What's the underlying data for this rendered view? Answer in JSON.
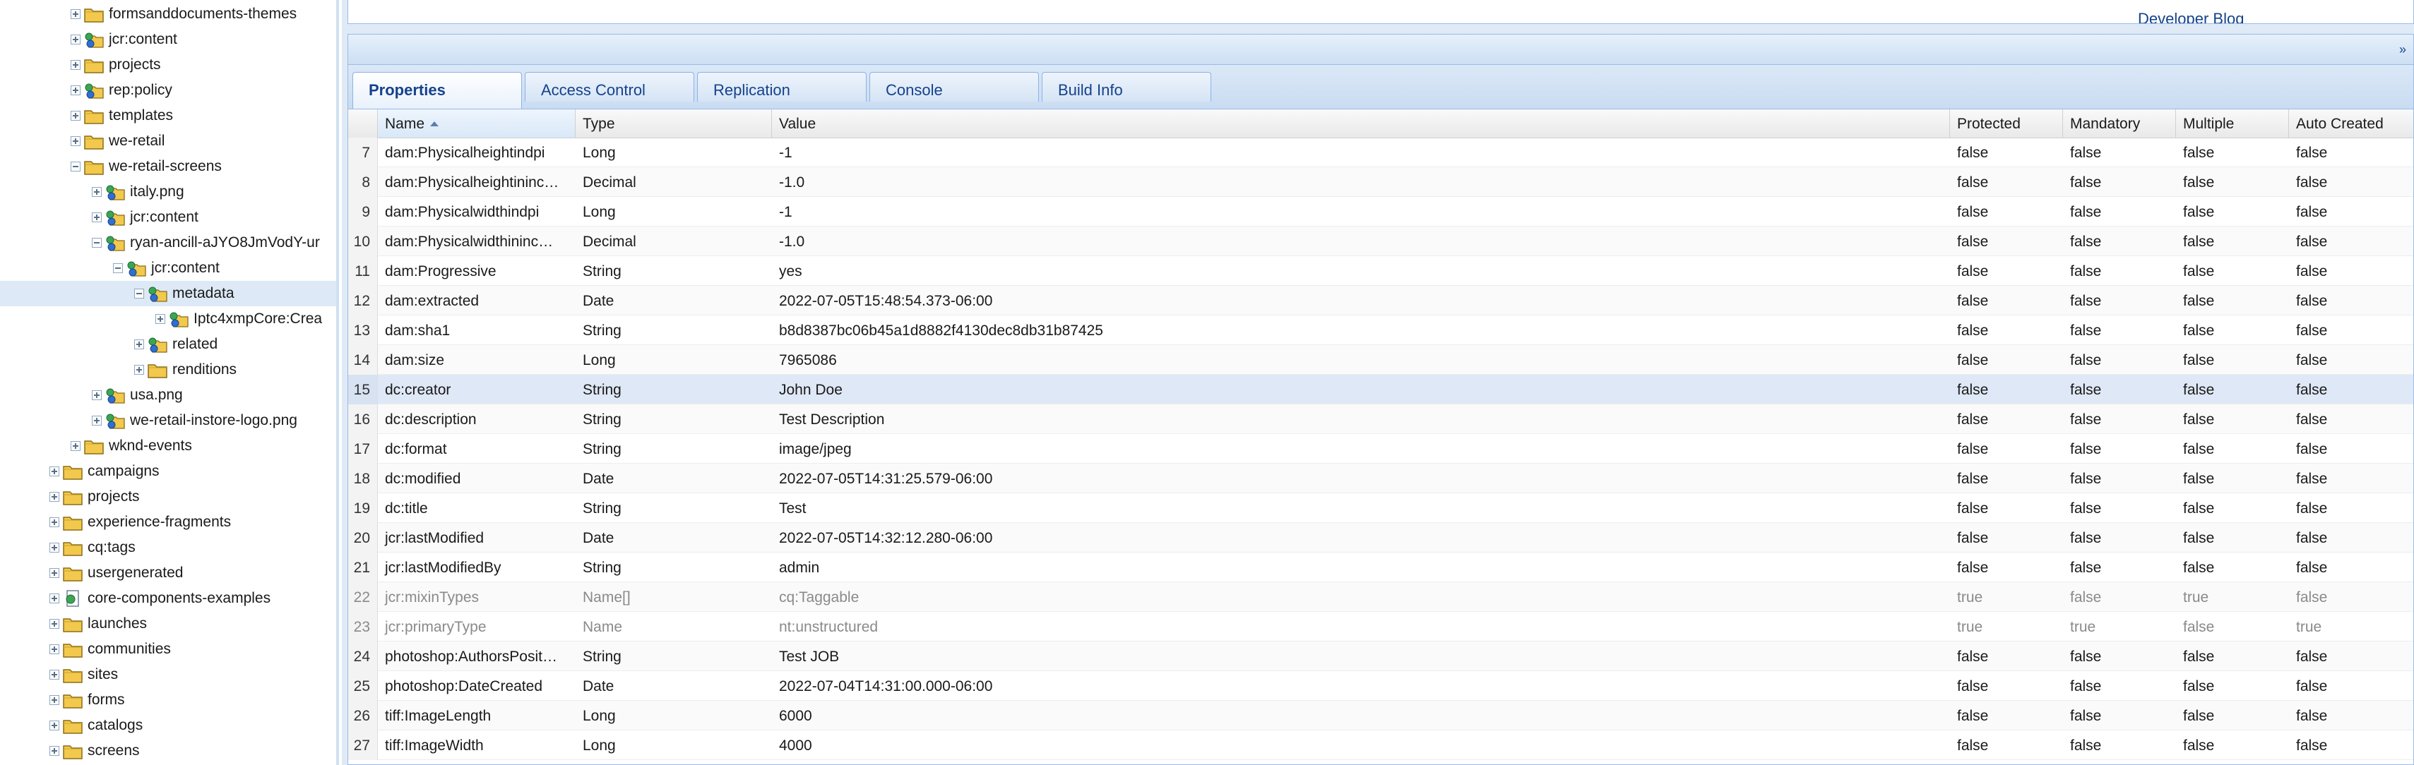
{
  "tree": {
    "items": [
      {
        "label": "formsanddocuments-themes",
        "toggle": "plus",
        "icon": "folder",
        "level": 3
      },
      {
        "label": "jcr:content",
        "toggle": "plus",
        "icon": "node",
        "level": 3
      },
      {
        "label": "projects",
        "toggle": "plus",
        "icon": "folder",
        "level": 3
      },
      {
        "label": "rep:policy",
        "toggle": "plus",
        "icon": "node",
        "level": 3
      },
      {
        "label": "templates",
        "toggle": "plus",
        "icon": "folder",
        "level": 3
      },
      {
        "label": "we-retail",
        "toggle": "plus",
        "icon": "folder",
        "level": 3
      },
      {
        "label": "we-retail-screens",
        "toggle": "minus",
        "icon": "folder",
        "level": 3
      },
      {
        "label": "italy.png",
        "toggle": "plus",
        "icon": "node",
        "level": 4
      },
      {
        "label": "jcr:content",
        "toggle": "plus",
        "icon": "node",
        "level": 4
      },
      {
        "label": "ryan-ancill-aJYO8JmVodY-ur",
        "toggle": "minus",
        "icon": "node",
        "level": 4
      },
      {
        "label": "jcr:content",
        "toggle": "minus",
        "icon": "node",
        "level": 5
      },
      {
        "label": "metadata",
        "toggle": "minus",
        "icon": "node",
        "level": 6,
        "selected": true
      },
      {
        "label": "Iptc4xmpCore:Crea",
        "toggle": "plus",
        "icon": "node",
        "level": 7
      },
      {
        "label": "related",
        "toggle": "plus",
        "icon": "node",
        "level": 6
      },
      {
        "label": "renditions",
        "toggle": "plus",
        "icon": "folder",
        "level": 6
      },
      {
        "label": "usa.png",
        "toggle": "plus",
        "icon": "node",
        "level": 4
      },
      {
        "label": "we-retail-instore-logo.png",
        "toggle": "plus",
        "icon": "node",
        "level": 4
      },
      {
        "label": "wknd-events",
        "toggle": "plus",
        "icon": "folder",
        "level": 3
      },
      {
        "label": "campaigns",
        "toggle": "plus",
        "icon": "folder",
        "level": 2
      },
      {
        "label": "projects",
        "toggle": "plus",
        "icon": "folder",
        "level": 2
      },
      {
        "label": "experience-fragments",
        "toggle": "plus",
        "icon": "folder",
        "level": 2
      },
      {
        "label": "cq:tags",
        "toggle": "plus",
        "icon": "folder",
        "level": 2
      },
      {
        "label": "usergenerated",
        "toggle": "plus",
        "icon": "folder",
        "level": 2
      },
      {
        "label": "core-components-examples",
        "toggle": "plus",
        "icon": "page",
        "level": 2
      },
      {
        "label": "launches",
        "toggle": "plus",
        "icon": "folder",
        "level": 2
      },
      {
        "label": "communities",
        "toggle": "plus",
        "icon": "folder",
        "level": 2
      },
      {
        "label": "sites",
        "toggle": "plus",
        "icon": "folder",
        "level": 2
      },
      {
        "label": "forms",
        "toggle": "plus",
        "icon": "folder",
        "level": 2
      },
      {
        "label": "catalogs",
        "toggle": "plus",
        "icon": "folder",
        "level": 2
      },
      {
        "label": "screens",
        "toggle": "plus",
        "icon": "folder",
        "level": 2
      }
    ]
  },
  "top_panel": {
    "link": "Developer Blog"
  },
  "collapse_icon": "double-chevron-down-icon",
  "tabs": [
    {
      "label": "Properties",
      "active": true
    },
    {
      "label": "Access Control",
      "active": false
    },
    {
      "label": "Replication",
      "active": false
    },
    {
      "label": "Console",
      "active": false
    },
    {
      "label": "Build Info",
      "active": false
    }
  ],
  "grid": {
    "columns": [
      "",
      "Name",
      "Type",
      "Value",
      "Protected",
      "Mandatory",
      "Multiple",
      "Auto Created"
    ],
    "sorted_column": "Name",
    "rows": [
      [
        "7",
        "dam:Physicalheightindpi",
        "Long",
        "-1",
        "false",
        "false",
        "false",
        "false"
      ],
      [
        "8",
        "dam:Physicalheightininc…",
        "Decimal",
        "-1.0",
        "false",
        "false",
        "false",
        "false"
      ],
      [
        "9",
        "dam:Physicalwidthindpi",
        "Long",
        "-1",
        "false",
        "false",
        "false",
        "false"
      ],
      [
        "10",
        "dam:Physicalwidthininc…",
        "Decimal",
        "-1.0",
        "false",
        "false",
        "false",
        "false"
      ],
      [
        "11",
        "dam:Progressive",
        "String",
        "yes",
        "false",
        "false",
        "false",
        "false"
      ],
      [
        "12",
        "dam:extracted",
        "Date",
        "2022-07-05T15:48:54.373-06:00",
        "false",
        "false",
        "false",
        "false"
      ],
      [
        "13",
        "dam:sha1",
        "String",
        "b8d8387bc06b45a1d8882f4130dec8db31b87425",
        "false",
        "false",
        "false",
        "false"
      ],
      [
        "14",
        "dam:size",
        "Long",
        "7965086",
        "false",
        "false",
        "false",
        "false"
      ],
      [
        "15",
        "dc:creator",
        "String",
        "John Doe",
        "false",
        "false",
        "false",
        "false"
      ],
      [
        "16",
        "dc:description",
        "String",
        "Test Description",
        "false",
        "false",
        "false",
        "false"
      ],
      [
        "17",
        "dc:format",
        "String",
        "image/jpeg",
        "false",
        "false",
        "false",
        "false"
      ],
      [
        "18",
        "dc:modified",
        "Date",
        "2022-07-05T14:31:25.579-06:00",
        "false",
        "false",
        "false",
        "false"
      ],
      [
        "19",
        "dc:title",
        "String",
        "Test",
        "false",
        "false",
        "false",
        "false"
      ],
      [
        "20",
        "jcr:lastModified",
        "Date",
        "2022-07-05T14:32:12.280-06:00",
        "false",
        "false",
        "false",
        "false"
      ],
      [
        "21",
        "jcr:lastModifiedBy",
        "String",
        "admin",
        "false",
        "false",
        "false",
        "false"
      ],
      [
        "22",
        "jcr:mixinTypes",
        "Name[]",
        "cq:Taggable",
        "true",
        "false",
        "true",
        "false"
      ],
      [
        "23",
        "jcr:primaryType",
        "Name",
        "nt:unstructured",
        "true",
        "true",
        "false",
        "true"
      ],
      [
        "24",
        "photoshop:AuthorsPosit…",
        "String",
        "Test JOB",
        "false",
        "false",
        "false",
        "false"
      ],
      [
        "25",
        "photoshop:DateCreated",
        "Date",
        "2022-07-04T14:31:00.000-06:00",
        "false",
        "false",
        "false",
        "false"
      ],
      [
        "26",
        "tiff:ImageLength",
        "Long",
        "6000",
        "false",
        "false",
        "false",
        "false"
      ],
      [
        "27",
        "tiff:ImageWidth",
        "Long",
        "4000",
        "false",
        "false",
        "false",
        "false"
      ]
    ],
    "selected_row": "15",
    "protected_rows": [
      "22",
      "23"
    ]
  }
}
